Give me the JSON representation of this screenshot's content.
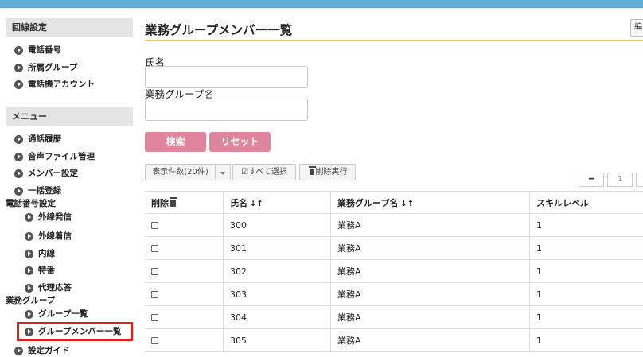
{
  "sidebar": {
    "section_line": "回線設定",
    "line_items": [
      "電話番号",
      "所属グループ",
      "電話機アカウント"
    ],
    "section_menu": "メニュー",
    "menu_items": [
      "通話履歴",
      "音声ファイル管理",
      "メンバー設定",
      "一括登録"
    ],
    "group_phone": "電話番号設定",
    "phone_items": [
      "外線発信",
      "外線着信",
      "内線",
      "特番",
      "代理応答"
    ],
    "group_business": "業務グループ",
    "business_items": [
      "グループ一覧",
      "グループメンバー一覧"
    ],
    "last_item": "設定ガイド"
  },
  "main": {
    "title": "業務グループメンバー一覧",
    "corner_button": "編",
    "form": {
      "name_label": "氏名",
      "name_value": "",
      "group_label": "業務グループ名",
      "group_value": ""
    },
    "search_button": "検索",
    "reset_button": "リセット",
    "toolbar": {
      "display_count": "表示件数(20件)",
      "select_all": "すべて選択",
      "delete_exec": "削除実行"
    },
    "pager": {
      "prev": "━",
      "page": "1"
    },
    "table": {
      "headers": [
        "削除",
        "氏名",
        "業務グループ名",
        "スキルレベル"
      ],
      "sort_icons": "↓↑",
      "rows": [
        [
          "300",
          "業務A",
          "1"
        ],
        [
          "301",
          "業務A",
          "1"
        ],
        [
          "302",
          "業務A",
          "1"
        ],
        [
          "303",
          "業務A",
          "1"
        ],
        [
          "304",
          "業務A",
          "1"
        ],
        [
          "305",
          "業務A",
          "1"
        ]
      ]
    }
  },
  "colors": {
    "topbar": "#5eafd6",
    "title_rule": "#e9c966",
    "primary_button": "#e0859e",
    "highlight": "#e01e1e"
  }
}
